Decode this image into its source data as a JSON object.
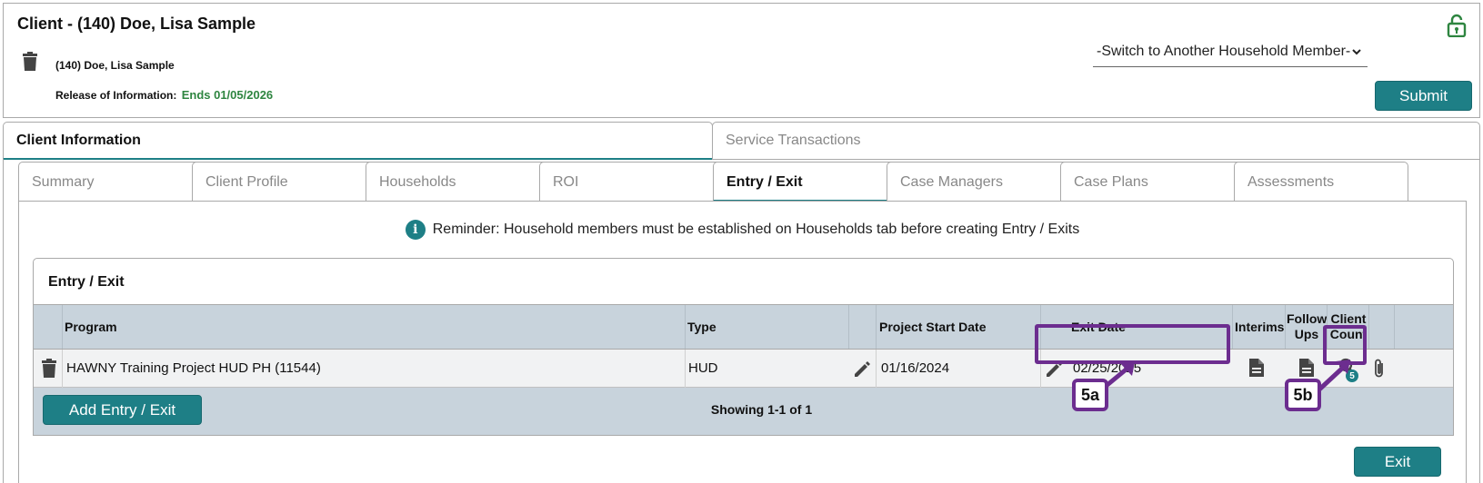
{
  "window": {
    "title": "Client - (140) Doe, Lisa Sample"
  },
  "client": {
    "name": "(140) Doe, Lisa Sample",
    "roi_label": "Release of Information:",
    "roi_value": "Ends 01/05/2026"
  },
  "household": {
    "selected": "-Switch to Another Household Member-",
    "submit_label": "Submit"
  },
  "top_tabs": [
    {
      "label": "Client Information",
      "active": true
    },
    {
      "label": "Service Transactions",
      "active": false
    }
  ],
  "sub_tabs": [
    {
      "label": "Summary"
    },
    {
      "label": "Client Profile"
    },
    {
      "label": "Households"
    },
    {
      "label": "ROI"
    },
    {
      "label": "Entry / Exit",
      "active": true
    },
    {
      "label": "Case Managers"
    },
    {
      "label": "Case Plans"
    },
    {
      "label": "Assessments"
    }
  ],
  "reminder": "Reminder: Household members must be established on Households tab before creating Entry / Exits",
  "entry_exit": {
    "title": "Entry / Exit",
    "columns": {
      "program": "Program",
      "type": "Type",
      "start": "Project Start Date",
      "exit": "Exit Date",
      "interims": "Interims",
      "follow_ups_1": "Follow",
      "follow_ups_2": "Ups",
      "client_count_1": "Client",
      "client_count_2": "Count"
    },
    "rows": [
      {
        "program": "HAWNY Training Project HUD PH (11544)",
        "type": "HUD",
        "start": "01/16/2024",
        "exit": "02/25/2025",
        "client_count_badge": "5"
      }
    ],
    "add_label": "Add Entry / Exit",
    "showing": "Showing 1-1 of 1"
  },
  "annotations": {
    "a": "5a",
    "b": "5b"
  },
  "exit_label": "Exit",
  "colors": {
    "accent": "#1e7f86",
    "header_bg": "#c8d3dc",
    "callout": "#6c2d8f",
    "roi_green": "#2e8540"
  }
}
